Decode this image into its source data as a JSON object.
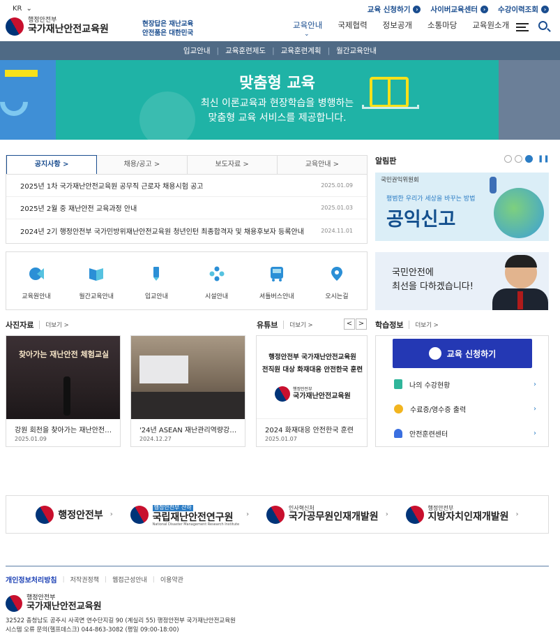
{
  "header": {
    "lang": "KR",
    "top_links": [
      "교육 신청하기",
      "사이버교육센터",
      "수강이력조회"
    ],
    "logo_small": "행정안전부",
    "logo_big": "국가재난안전교육원",
    "slogan_l1": "현장답은 재난교육",
    "slogan_l2": "안전품은 대한민국",
    "gnb": [
      "교육안내",
      "국제협력",
      "정보공개",
      "소통마당",
      "교육원소개"
    ]
  },
  "subnav": [
    "입교안내",
    "교육훈련제도",
    "교육훈련계획",
    "월간교육안내"
  ],
  "banner": {
    "title": "맞춤형 교육",
    "sub1": "최신 이론교육과 현장학습을 병행하는",
    "sub2": "맞춤형 교육 서비스를 제공합니다."
  },
  "notice": {
    "tabs": [
      "공지사항 >",
      "채용/공고 >",
      "보도자료 >",
      "교육안내 >"
    ],
    "rows": [
      {
        "title": "2025년 1차 국가재난안전교육원 공무직 근로자 채용시험 공고",
        "date": "2025.01.09"
      },
      {
        "title": "2025년 2월 중 재난안전 교육과정 안내",
        "date": "2025.01.03"
      },
      {
        "title": "2024년 2기 행정안전부 국가민방위재난안전교육원 청년인턴 최종합격자 및 채용후보자 등록안내",
        "date": "2024.11.01"
      }
    ]
  },
  "bulletin": {
    "title": "알림판",
    "org": "국민권익위원회",
    "tag": "평범한 우리가 세상을 바꾸는 방법",
    "big": "공익신고"
  },
  "quick": [
    "교육원안내",
    "월간교육안내",
    "입교안내",
    "시설안내",
    "셔틀버스안내",
    "오시는길"
  ],
  "minister": {
    "l1": "국민안전에",
    "l2": "최선을 다하겠습니다!"
  },
  "photo": {
    "title": "사진자료",
    "more": "더보기 >",
    "items": [
      {
        "banner": "찾아가는 재난안전 체험교실",
        "caption": "강원 회천을 찾아가는 재난안전…",
        "date": "2025.01.09"
      },
      {
        "caption": "'24년 ASEAN 재난관리역량강…",
        "date": "2024.12.27"
      }
    ]
  },
  "youtube": {
    "title": "유튜브",
    "more": "더보기 >",
    "line1": "행정안전부 국가재난안전교육원",
    "line2": "전직원 대상 화재대응 안전한국 훈련",
    "logo_small": "행정안전부",
    "logo_big": "국가재난안전교육원",
    "caption": "2024 화재대응 안전한국 훈련",
    "date": "2025.01.07",
    "prev": "<",
    "next": ">"
  },
  "learn": {
    "title": "학습정보",
    "more": "더보기 >",
    "button": "교육 신청하기",
    "items": [
      "나의 수강현황",
      "수료증/영수증 출력",
      "안전훈련센터"
    ]
  },
  "partners": [
    {
      "name": "행정안전부"
    },
    {
      "tag": "행정안전부 산하",
      "name": "국립재난안전연구원",
      "sub": "National Disaster Management Research Institute"
    },
    {
      "small": "인사혁신처",
      "name": "국가공무원인재개발원"
    },
    {
      "small": "행정안전부",
      "name": "지방자치인재개발원"
    }
  ],
  "footer": {
    "links": [
      "개인정보처리방침",
      "저작권정책",
      "웹접근성안내",
      "이용약관"
    ],
    "logo_small": "행정안전부",
    "logo_big": "국가재난안전교육원",
    "addr1": "32522 충청남도 공주시 사곡면 연수단지길 90 (계실리 55) 행정안전부 국가재난안전교육원",
    "addr2": "시스템 오류 문의(헬프데스크) 044-863-3082 (평일 09:00-18:00)"
  }
}
